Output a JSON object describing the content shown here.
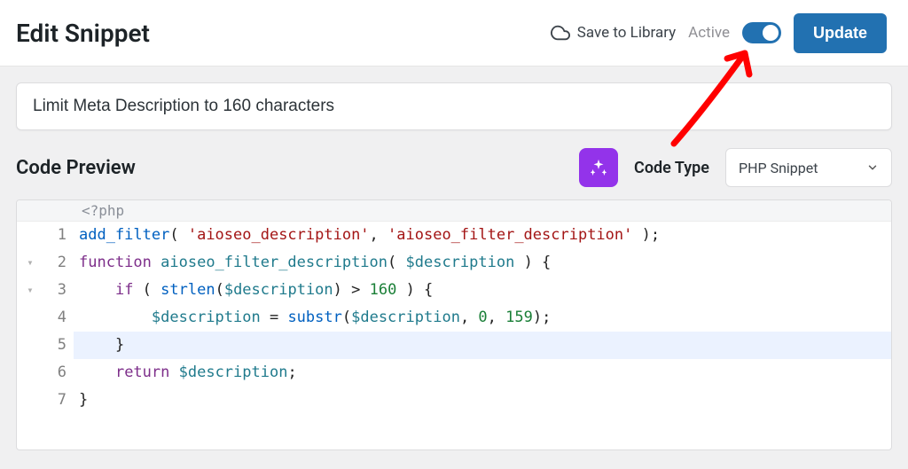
{
  "header": {
    "title": "Edit Snippet",
    "save_to_library": "Save to Library",
    "active_label": "Active",
    "toggle_on": true,
    "update_label": "Update"
  },
  "snippet": {
    "title_value": "Limit Meta Description to 160 characters"
  },
  "preview": {
    "section_title": "Code Preview",
    "code_type_label": "Code Type",
    "code_type_value": "PHP Snippet"
  },
  "editor": {
    "prologue": "<?php",
    "lines": [
      {
        "n": 1,
        "fold": "",
        "hl": false
      },
      {
        "n": 2,
        "fold": "▾",
        "hl": false
      },
      {
        "n": 3,
        "fold": "▾",
        "hl": false
      },
      {
        "n": 4,
        "fold": "",
        "hl": false
      },
      {
        "n": 5,
        "fold": "",
        "hl": true
      },
      {
        "n": 6,
        "fold": "",
        "hl": false
      },
      {
        "n": 7,
        "fold": "",
        "hl": false
      }
    ],
    "tokens": {
      "l1": {
        "fn1": "add_filter",
        "p1": "( ",
        "s1": "'aioseo_description'",
        "c": ", ",
        "s2": "'aioseo_filter_description'",
        "p2": " );"
      },
      "l2": {
        "kw": "function",
        "sp": " ",
        "name": "aioseo_filter_description",
        "p1": "( ",
        "var": "$description",
        "p2": " ) {"
      },
      "l3": {
        "indent": "    ",
        "kw": "if",
        "sp": " ( ",
        "fn": "strlen",
        "p1": "(",
        "var": "$description",
        "p2": ") > ",
        "num": "160",
        "p3": " ) {"
      },
      "l4": {
        "indent": "        ",
        "var1": "$description",
        "eq": " = ",
        "fn": "substr",
        "p1": "(",
        "var2": "$description",
        "c1": ", ",
        "n1": "0",
        "c2": ", ",
        "n2": "159",
        "p2": ");"
      },
      "l5": {
        "indent": "    ",
        "brace": "}"
      },
      "l6": {
        "indent": "    ",
        "kw": "return",
        "sp": " ",
        "var": "$description",
        "semi": ";"
      },
      "l7": {
        "brace": "}"
      }
    }
  }
}
